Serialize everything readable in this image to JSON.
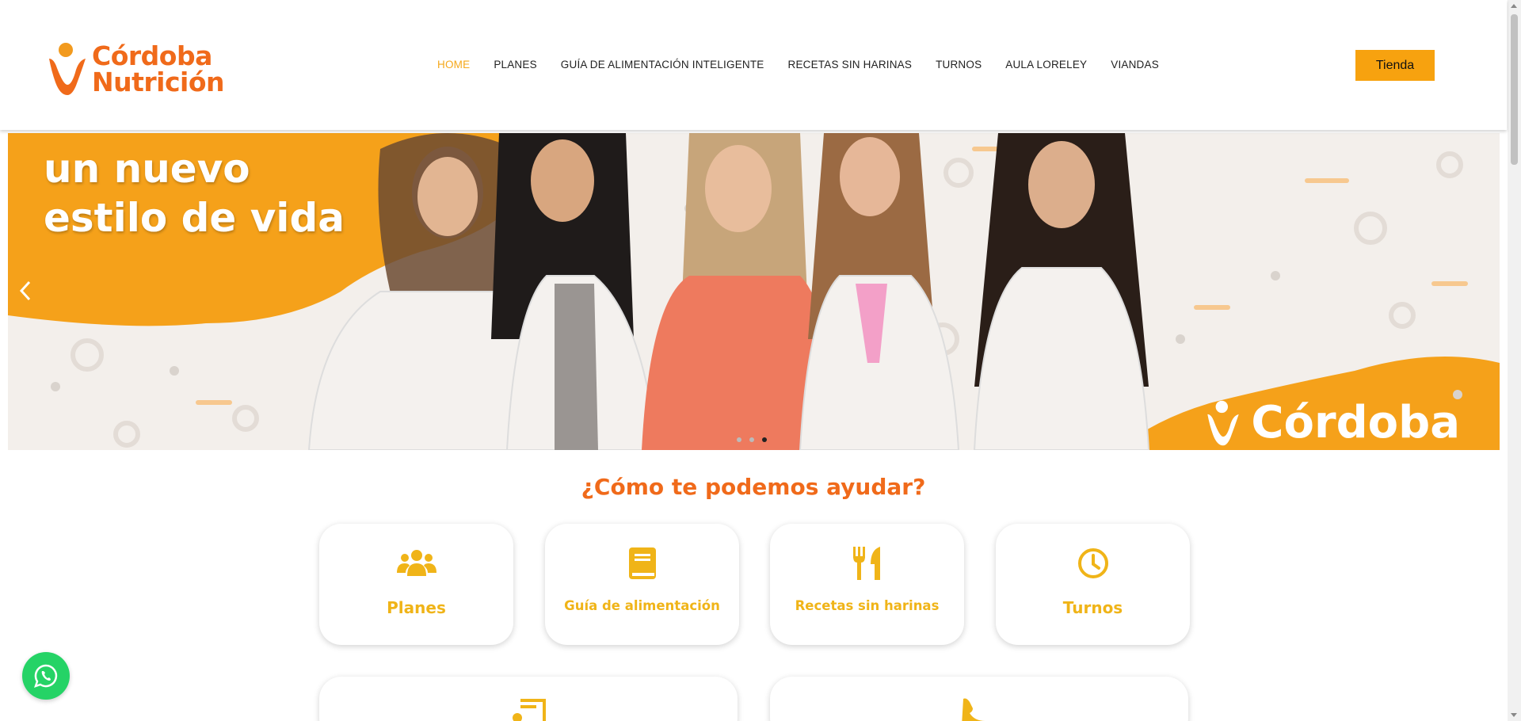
{
  "brand": {
    "line1": "Córdoba",
    "line2": "Nutrición",
    "accent": "#f06a1a"
  },
  "nav": {
    "items": [
      {
        "label": "HOME",
        "active": true
      },
      {
        "label": "PLANES"
      },
      {
        "label": "GUÍA DE ALIMENTACIÓN INTELIGENTE"
      },
      {
        "label": "RECETAS SIN HARINAS"
      },
      {
        "label": "TURNOS"
      },
      {
        "label": "AULA LORELEY"
      },
      {
        "label": "VIANDAS"
      }
    ],
    "active_color": "#f5a81c"
  },
  "shop_button": {
    "label": "Tienda",
    "color": "#f7a20f"
  },
  "hero": {
    "line1": "un nuevo",
    "line2": "estilo de vida",
    "brand": "Córdoba",
    "slide_count": 3,
    "active_slide": 3,
    "prev_icon": "chevron-left-icon"
  },
  "section": {
    "title": "¿Cómo te podemos ayudar?",
    "cards": [
      {
        "label": "Planes",
        "icon": "users-icon"
      },
      {
        "label": "Guía de alimentación",
        "icon": "book-icon"
      },
      {
        "label": "Recetas sin harinas",
        "icon": "utensils-icon"
      },
      {
        "label": "Turnos",
        "icon": "clock-icon"
      }
    ],
    "wide_cards": [
      {
        "icon": "music-icon"
      },
      {
        "icon": "phone-icon"
      }
    ],
    "card_color": "#f0b418"
  },
  "whatsapp": {
    "icon": "whatsapp-icon",
    "color": "#25d366"
  }
}
